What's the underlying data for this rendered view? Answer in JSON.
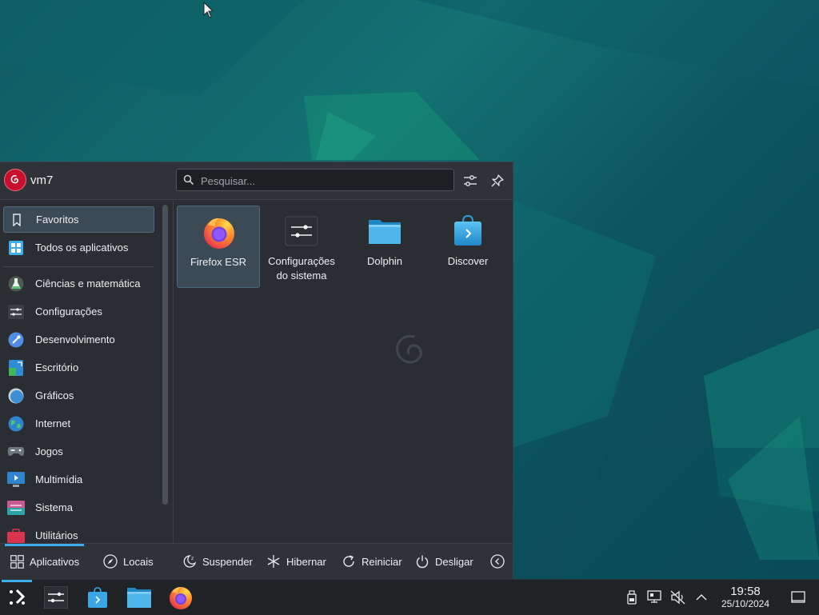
{
  "launcher": {
    "username": "vm7",
    "search_placeholder": "Pesquisar...",
    "sidebar": [
      {
        "label": "Favoritos",
        "icon": "bookmark-icon",
        "active": true
      },
      {
        "label": "Todos os aplicativos",
        "icon": "grid-apps-icon"
      },
      {
        "label": "Ciências e matemática",
        "icon": "science-flask-icon"
      },
      {
        "label": "Configurações",
        "icon": "settings-icon"
      },
      {
        "label": "Desenvolvimento",
        "icon": "development-icon"
      },
      {
        "label": "Escritório",
        "icon": "office-icon"
      },
      {
        "label": "Gráficos",
        "icon": "graphics-icon"
      },
      {
        "label": "Internet",
        "icon": "globe-icon"
      },
      {
        "label": "Jogos",
        "icon": "gamepad-icon"
      },
      {
        "label": "Multimídia",
        "icon": "multimedia-icon"
      },
      {
        "label": "Sistema",
        "icon": "system-icon"
      },
      {
        "label": "Utilitários",
        "icon": "utilities-icon"
      }
    ],
    "apps": [
      {
        "label": "Firefox ESR",
        "icon": "firefox-icon",
        "active": true
      },
      {
        "label": "Configurações do sistema",
        "label_line1": "Configurações",
        "label_line2": "do sistema",
        "icon": "system-settings-icon"
      },
      {
        "label": "Dolphin",
        "icon": "folder-icon"
      },
      {
        "label": "Discover",
        "icon": "discover-bag-icon"
      }
    ],
    "footer": {
      "applications": "Aplicativos",
      "places": "Locais",
      "suspend": "Suspender",
      "hibernate": "Hibernar",
      "restart": "Reiniciar",
      "shutdown": "Desligar"
    }
  },
  "taskbar": {
    "time": "19:58",
    "date": "25/10/2024"
  },
  "colors": {
    "accent": "#3daee9",
    "panel": "#2a2e32",
    "taskbar": "#1f2326",
    "debian_red": "#c8102e"
  }
}
